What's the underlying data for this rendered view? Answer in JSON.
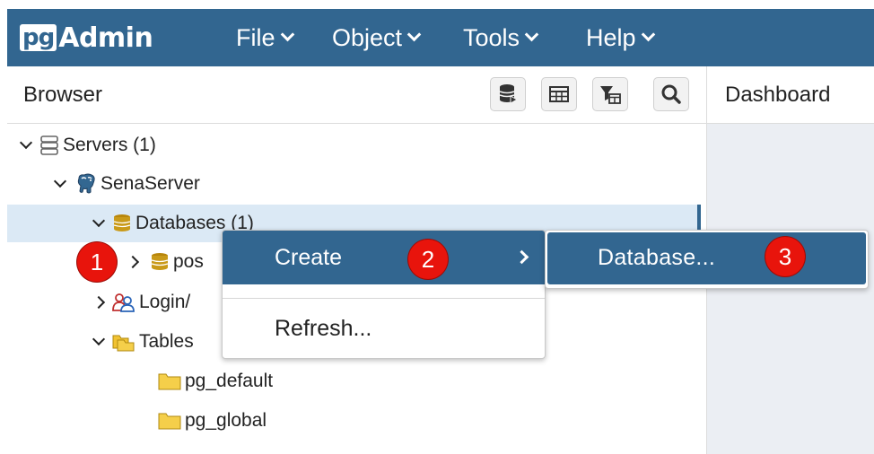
{
  "app": {
    "logo_pg": "pg",
    "logo_admin": "Admin",
    "menu": [
      {
        "label": "File"
      },
      {
        "label": "Object"
      },
      {
        "label": "Tools"
      },
      {
        "label": "Help"
      }
    ]
  },
  "browser": {
    "title": "Browser",
    "toolbar_icons": [
      "database-query-icon",
      "table-grid-icon",
      "filtered-table-icon",
      "search-icon"
    ]
  },
  "dashboard": {
    "title": "Dashboard"
  },
  "tree": {
    "servers": "Servers (1)",
    "server_name": "SenaServer",
    "databases": "Databases (1)",
    "database_item": "pos",
    "login_roles": "Login/",
    "tablespaces": "Tables",
    "pg_default": "pg_default",
    "pg_global": "pg_global"
  },
  "context_menu": {
    "create_label": "Create",
    "refresh_label": "Refresh..."
  },
  "submenu": {
    "database_label": "Database..."
  },
  "callouts": [
    "1",
    "2",
    "3"
  ],
  "colors": {
    "brand": "#326690",
    "callout": "#e8140c",
    "selection": "#dbe9f5"
  }
}
